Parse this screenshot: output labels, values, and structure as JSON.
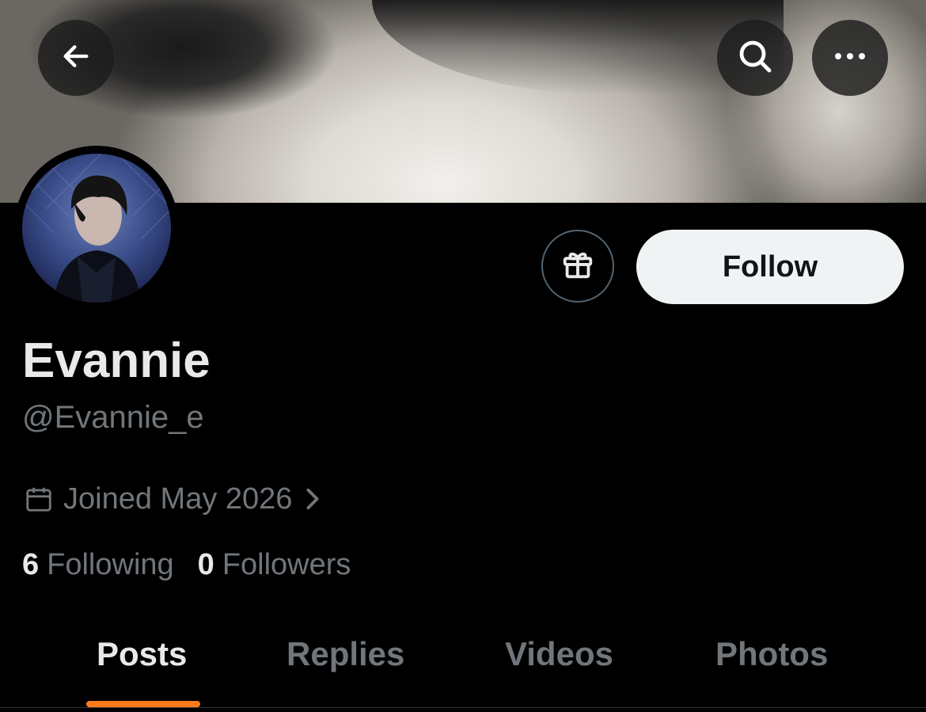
{
  "header": {
    "back_icon": "arrow-left-icon",
    "search_icon": "search-icon",
    "more_icon": "more-horizontal-icon"
  },
  "profile": {
    "display_name": "Evannie",
    "handle": "@Evannie_e",
    "joined": "Joined May 2026",
    "following_count": "6",
    "following_label": "Following",
    "followers_count": "0",
    "followers_label": "Followers"
  },
  "actions": {
    "gift_icon": "gift-icon",
    "follow_label": "Follow"
  },
  "tabs": [
    {
      "label": "Posts",
      "active": true
    },
    {
      "label": "Replies",
      "active": false
    },
    {
      "label": "Videos",
      "active": false
    },
    {
      "label": "Photos",
      "active": false
    }
  ],
  "colors": {
    "accent_indicator": "#ff7a1a",
    "muted_text": "#71767b",
    "primary_text": "#e7e9ea",
    "follow_button_bg": "#eff3f4"
  }
}
